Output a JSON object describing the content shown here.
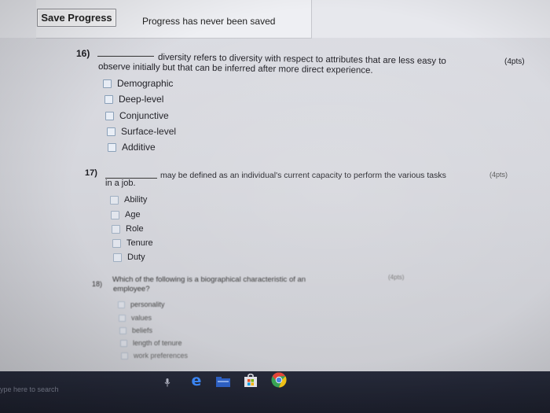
{
  "toolbar": {
    "save_label": "Save Progress",
    "status": "Progress has never been saved"
  },
  "questions": [
    {
      "number": "16)",
      "text_line1": "diversity refers to diversity with respect to attributes that are less easy to",
      "text_line2": "observe initially but that can be inferred after more direct experience.",
      "points": "(4pts)",
      "options": [
        "Demographic",
        "Deep-level",
        "Conjunctive",
        "Surface-level",
        "Additive"
      ]
    },
    {
      "number": "17)",
      "text_line1": "may be defined as an individual's current capacity to perform the various tasks",
      "text_line2": "in a job.",
      "points": "(4pts)",
      "options": [
        "Ability",
        "Age",
        "Role",
        "Tenure",
        "Duty"
      ]
    },
    {
      "number": "18)",
      "text_line1": "Which of the following is a biographical characteristic of an",
      "text_line2": "employee?",
      "points": "(4pts)",
      "options": [
        "personality",
        "values",
        "beliefs",
        "length of tenure",
        "work preferences"
      ]
    }
  ],
  "taskbar": {
    "search_placeholder": "ype here to search",
    "icons": [
      "microphone-icon",
      "edge-browser-icon",
      "file-explorer-icon",
      "store-icon",
      "chrome-icon"
    ]
  }
}
